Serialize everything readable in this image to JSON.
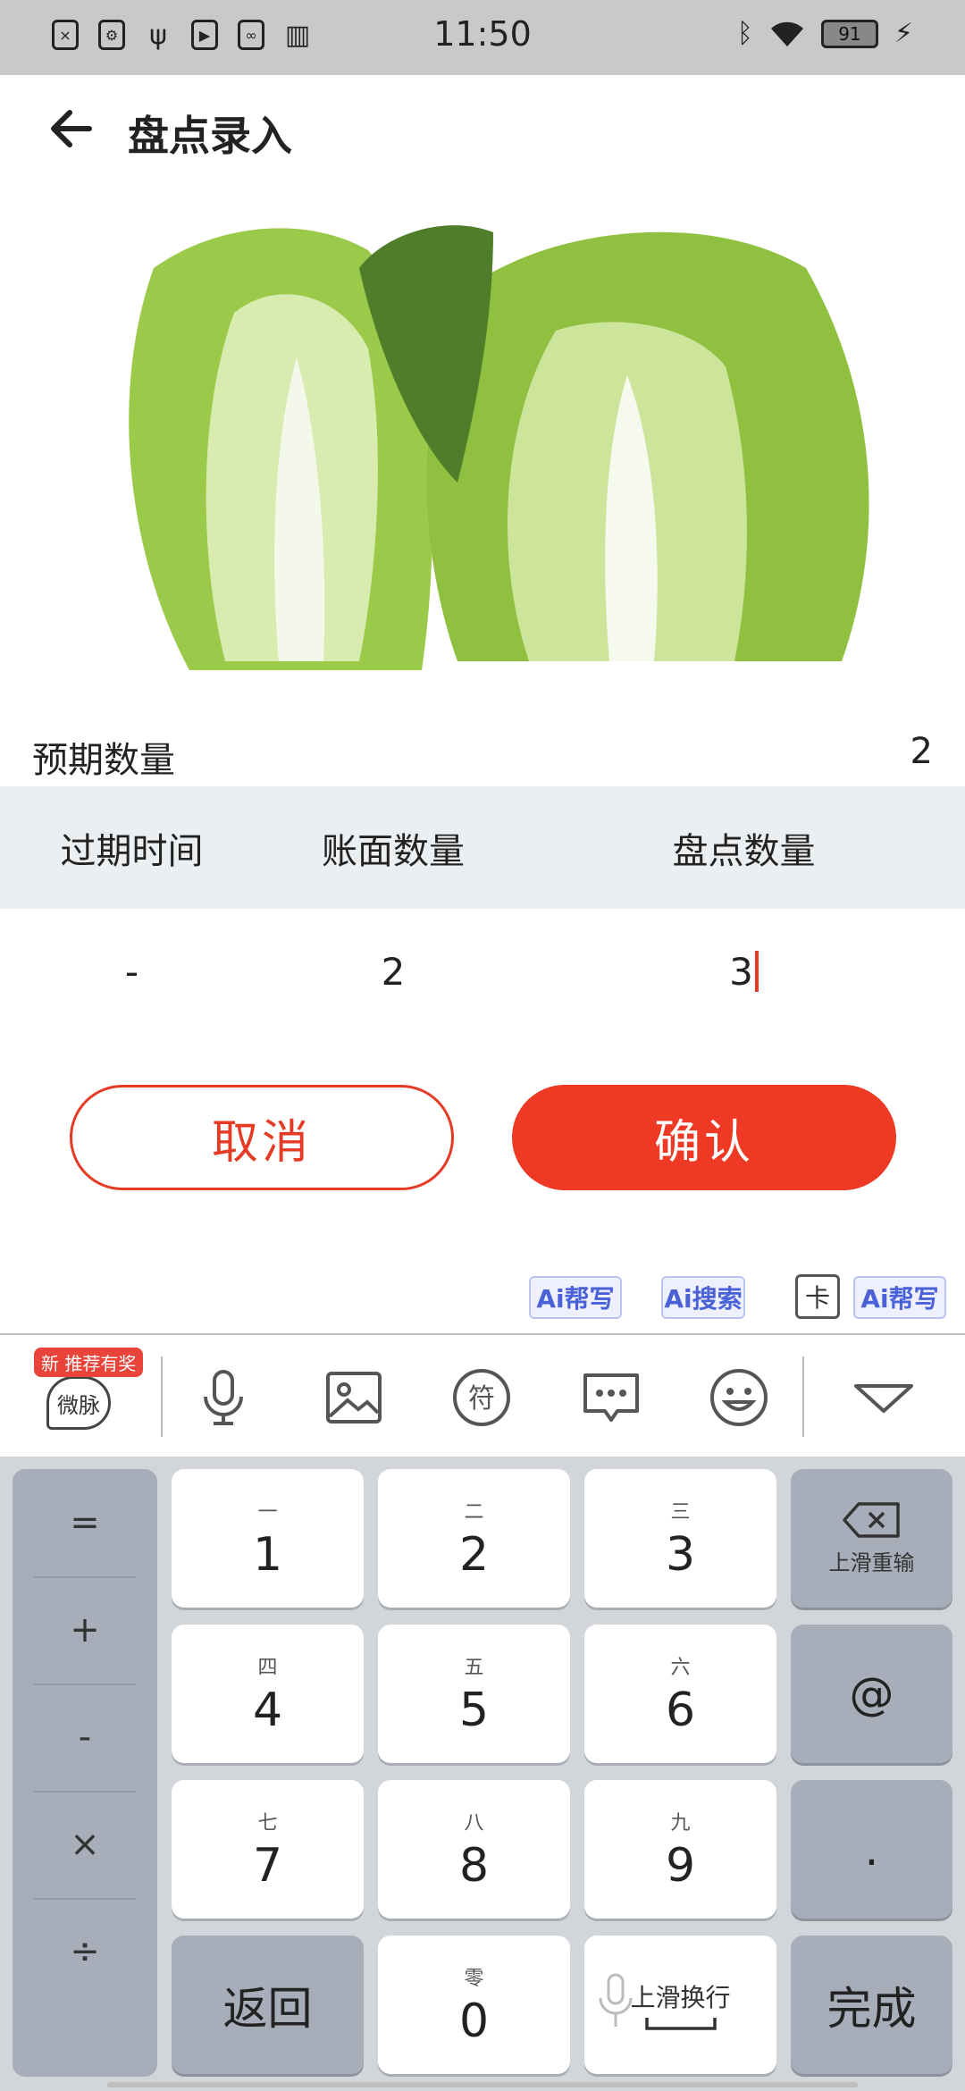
{
  "status": {
    "time": "11:50",
    "battery": "91",
    "left_icons": [
      "file-x-icon",
      "usb-debug-icon",
      "usb-icon",
      "play-icon",
      "link-icon",
      "book-icon"
    ],
    "right_icons": [
      "bluetooth-icon",
      "wifi-icon",
      "battery-icon",
      "charging-icon"
    ]
  },
  "header": {
    "title": "盘点录入"
  },
  "expected": {
    "label": "预期数量",
    "value": "2"
  },
  "table": {
    "headers": [
      "过期时间",
      "账面数量",
      "盘点数量"
    ],
    "row": {
      "expiry": "-",
      "book_qty": "2",
      "count_qty": "3"
    }
  },
  "buttons": {
    "cancel": "取消",
    "confirm": "确认"
  },
  "colors": {
    "accent": "#ee3a24",
    "header_bg": "#eceff1",
    "keyboard_bg": "#d2d5da"
  },
  "keyboard": {
    "chips": [
      "Ai帮写",
      "Ai搜索",
      "卡",
      "Ai帮写"
    ],
    "badge": "推荐有奖",
    "new_tag": "新",
    "weimai": "微脉",
    "side_keys": [
      "=",
      "+",
      "-",
      "×",
      "÷"
    ],
    "keys": [
      {
        "sub": "一",
        "main": "1"
      },
      {
        "sub": "二",
        "main": "2"
      },
      {
        "sub": "三",
        "main": "3"
      },
      {
        "sub": "四",
        "main": "4"
      },
      {
        "sub": "五",
        "main": "5"
      },
      {
        "sub": "六",
        "main": "6"
      },
      {
        "sub": "七",
        "main": "7"
      },
      {
        "sub": "八",
        "main": "8"
      },
      {
        "sub": "九",
        "main": "9"
      },
      {
        "sub": "零",
        "main": "0"
      }
    ],
    "backspace_hint": "上滑重输",
    "at": "@",
    "dot": ".",
    "back": "返回",
    "enter_hint": "上滑换行",
    "done": "完成"
  }
}
